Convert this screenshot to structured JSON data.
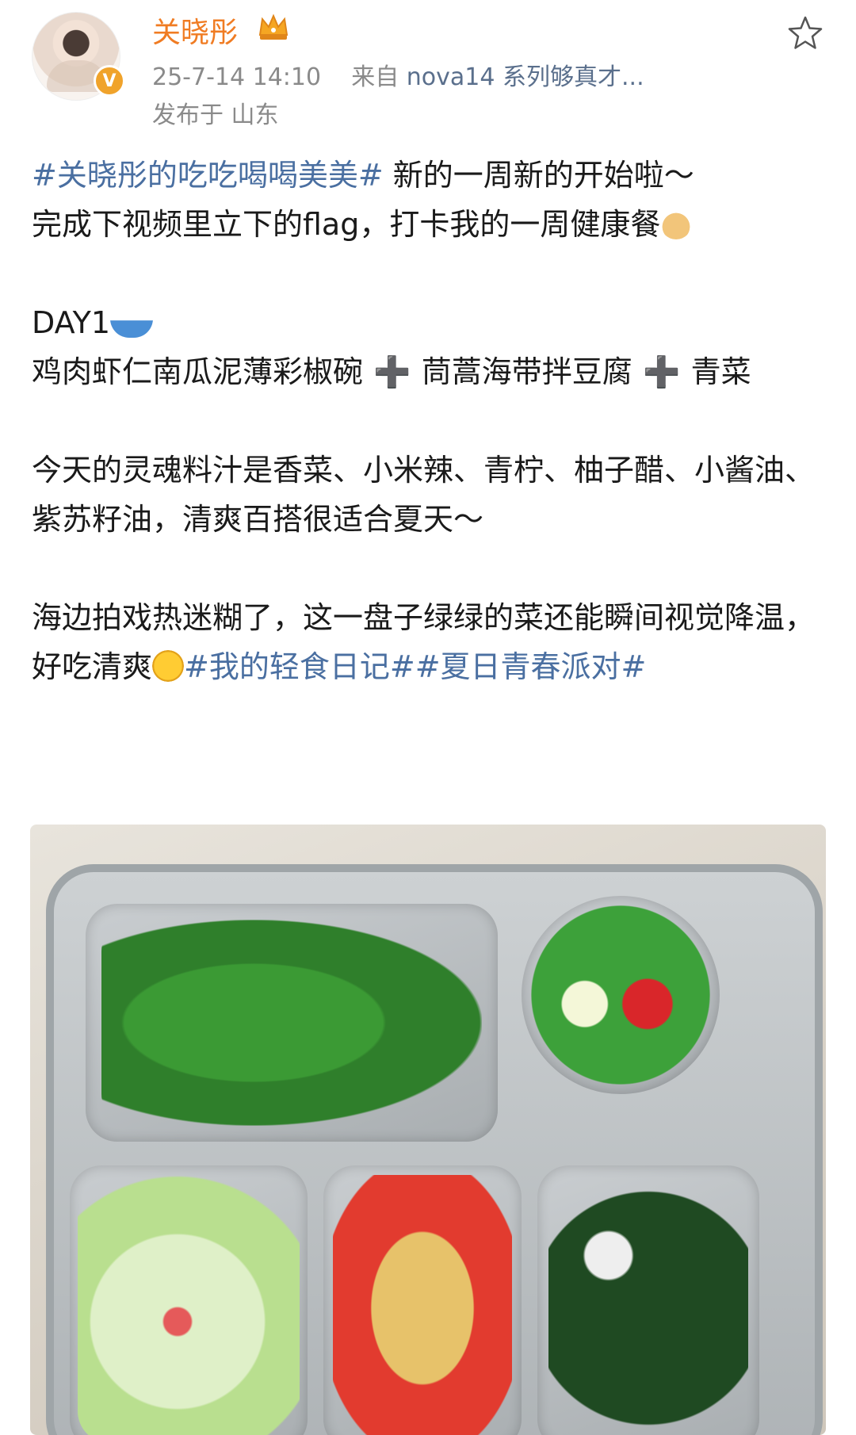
{
  "post": {
    "username": "关晓彤",
    "datetime": "25-7-14 14:10",
    "source_prefix": "来自",
    "source_device": "nova14 系列够真才...",
    "location": "发布于 山东"
  },
  "content": {
    "line1_topic": "#关晓彤的吃吃喝喝美美#",
    "line1_text": " 新的一周新的开始啦～",
    "line2_text": "完成下视频里立下的flag，打卡我的一周健康餐",
    "day_label": "DAY1",
    "menu_part1": "鸡肉虾仁南瓜泥薄彩椒碗",
    "menu_plus": " ➕ ",
    "menu_part2": "茼蒿海带拌豆腐",
    "menu_part3": "青菜",
    "sauce_text": "今天的灵魂料汁是香菜、小米辣、青柠、柚子醋、小酱油、紫苏籽油，清爽百搭很适合夏天～",
    "closing_text1": "海边拍戏热迷糊了，这一盘子绿绿的菜还能瞬间视觉降温，好吃清爽",
    "closing_topic1": "#我的轻食日记#",
    "closing_topic2": "#夏日青春派对#"
  },
  "icons": {
    "verified_badge": "V",
    "favorite": "star-icon",
    "crown": "crown-icon"
  },
  "colors": {
    "username": "#f07c23",
    "topic": "#4a6fa1",
    "meta": "#8a8a8a"
  }
}
